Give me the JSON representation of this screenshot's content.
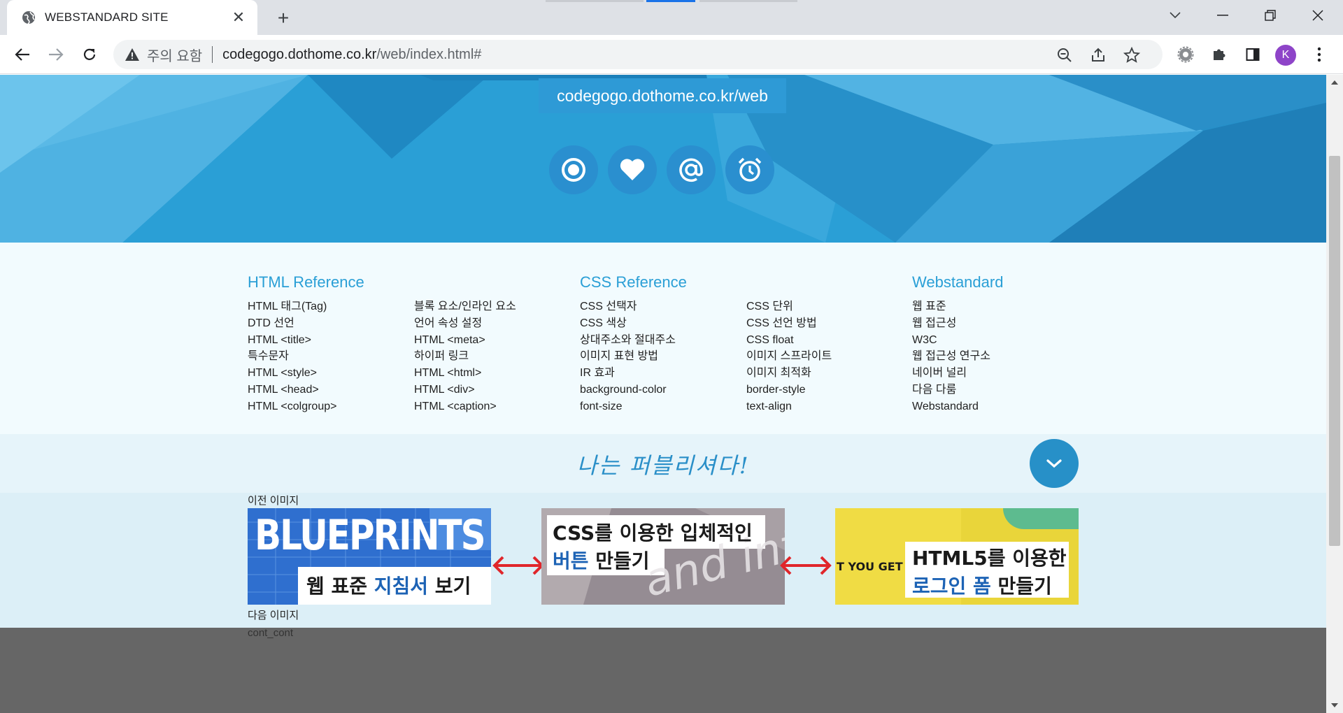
{
  "browser": {
    "tab_title": "WEBSTANDARD SITE",
    "security_label": "주의 요함",
    "url_host": "codegogo.dothome.co.kr",
    "url_path": "/web/index.html#",
    "profile_initial": "K"
  },
  "hero": {
    "url_badge": "codegogo.dothome.co.kr/web",
    "icons": [
      "target-icon",
      "heart-icon",
      "at-sign-icon",
      "alarm-clock-icon"
    ]
  },
  "columns": [
    {
      "title": "HTML Reference",
      "left": [
        "HTML 태그(Tag)",
        "DTD 선언",
        "HTML <title>",
        "특수문자",
        "HTML <style>",
        "HTML <head>",
        "HTML <colgroup>"
      ],
      "right": [
        "블록 요소/인라인 요소",
        "언어 속성 설정",
        "HTML <meta>",
        "하이퍼 링크",
        "HTML <html>",
        "HTML <div>",
        "HTML <caption>"
      ]
    },
    {
      "title": "CSS Reference",
      "left": [
        "CSS 선택자",
        "CSS 색상",
        "상대주소와 절대주소",
        "이미지 표현 방법",
        "IR 효과",
        "background-color",
        "font-size"
      ],
      "right": [
        "CSS 단위",
        "CSS 선언 방법",
        "CSS float",
        "이미지 스프라이트",
        "이미지 최적화",
        "border-style",
        "text-align"
      ]
    },
    {
      "title": "Webstandard",
      "left": [
        "웹 표준",
        "웹 접근성",
        "W3C",
        "웹 접근성 연구소",
        "네이버 널리",
        "다음 다룸",
        "Webstandard"
      ]
    }
  ],
  "slogan": "나는 퍼블리셔다!",
  "slider": {
    "prev_label": "이전 이미지",
    "next_label": "다음 이미지",
    "slides": [
      {
        "big": "BLUEPRINTS",
        "line1a": "웹 표준 ",
        "line1b": "지침서",
        "line1c": " 보기"
      },
      {
        "line1": "CSS를 이용한 입체적인",
        "line2a": "버튼",
        "line2b": " 만들기",
        "bg_text": "and inte"
      },
      {
        "small": "T YOU GET",
        "line1": "HTML5를 이용한",
        "line2a": "로그인 폼",
        "line2b": " 만들기"
      }
    ]
  },
  "footer_label": "cont_cont",
  "colors": {
    "accent": "#2a9fd6",
    "slide_blue": "#1d63b5",
    "arrow_red": "#e0262b",
    "footer": "#666666"
  }
}
